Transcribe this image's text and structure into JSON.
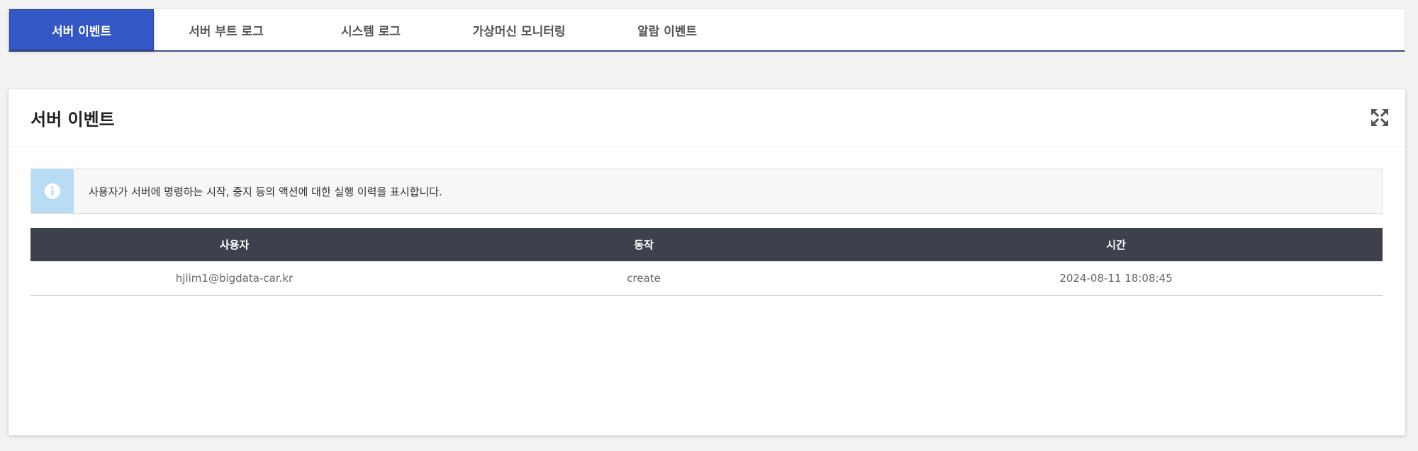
{
  "tabs": [
    {
      "label": "서버 이벤트",
      "active": true
    },
    {
      "label": "서버 부트 로그",
      "active": false
    },
    {
      "label": "시스템 로그",
      "active": false
    },
    {
      "label": "가상머신 모니터링",
      "active": false
    },
    {
      "label": "알람 이벤트",
      "active": false
    }
  ],
  "panel": {
    "title": "서버 이벤트",
    "expand_icon": "expand-arrows-icon",
    "info": {
      "icon": "info-icon",
      "text": "사용자가 서버에 명령하는 시작, 중지 등의 액션에 대한 실행 이력을 표시합니다."
    }
  },
  "table": {
    "columns": [
      "사용자",
      "동작",
      "시간"
    ],
    "rows": [
      [
        "hjlim1@bigdata-car.kr",
        "create",
        "2024-08-11 18:08:45"
      ]
    ]
  },
  "colors": {
    "active_tab": "#3358c6",
    "tab_underline": "#3e4f86",
    "table_header": "#3d414d",
    "info_icon_bg": "#b9dcf5"
  }
}
